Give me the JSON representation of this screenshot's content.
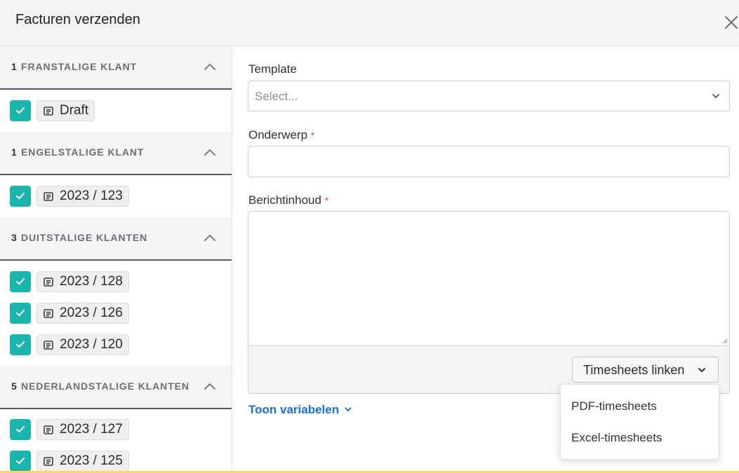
{
  "dialog": {
    "title": "Facturen verzenden",
    "close_icon": "close-icon"
  },
  "groups": [
    {
      "count": "1",
      "label": "FRANSTALIGE KLANT",
      "invoices": [
        {
          "label": "Draft",
          "checked": true
        }
      ]
    },
    {
      "count": "1",
      "label": "ENGELSTALIGE KLANT",
      "invoices": [
        {
          "label": "2023 / 123",
          "checked": true
        }
      ]
    },
    {
      "count": "3",
      "label": "DUITSTALIGE KLANTEN",
      "invoices": [
        {
          "label": "2023 / 128",
          "checked": true
        },
        {
          "label": "2023 / 126",
          "checked": true
        },
        {
          "label": "2023 / 120",
          "checked": true
        }
      ]
    },
    {
      "count": "5",
      "label": "NEDERLANDSTALIGE KLANTEN",
      "invoices": [
        {
          "label": "2023 / 127",
          "checked": true
        },
        {
          "label": "2023 / 125",
          "checked": true
        }
      ]
    }
  ],
  "form": {
    "template_label": "Template",
    "template_placeholder": "Select...",
    "subject_label": "Onderwerp",
    "body_label": "Berichtinhoud",
    "required_marker": "*",
    "subject_value": "",
    "body_value": ""
  },
  "toolbar": {
    "timesheets_button": "Timesheets linken"
  },
  "variables_link": "Toon variabelen",
  "dropdown": {
    "items": [
      "PDF-timesheets",
      "Excel-timesheets"
    ]
  },
  "colors": {
    "checkbox": "#1bb5ad",
    "link": "#1d6fdc",
    "required": "#d9534f",
    "group_header_bg": "#f4f4f5"
  }
}
